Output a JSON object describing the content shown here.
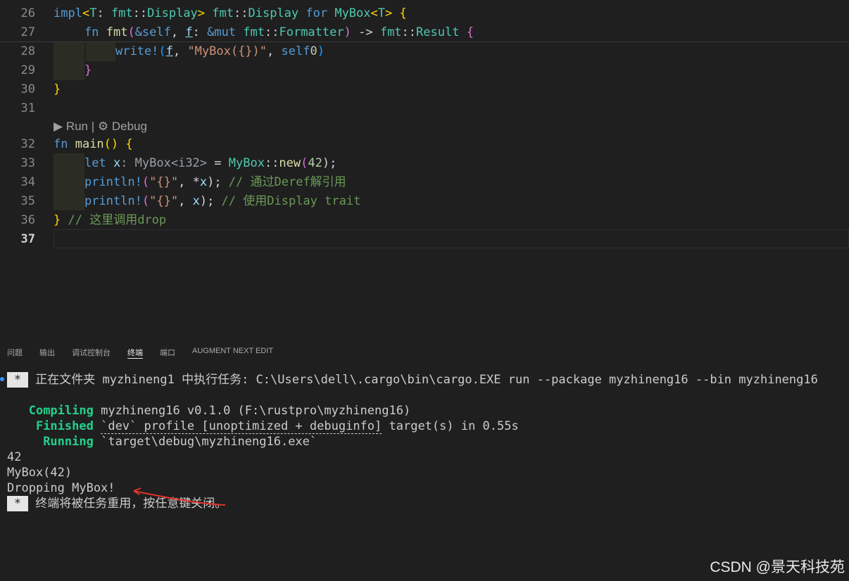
{
  "editor": {
    "line_numbers": [
      "26",
      "27",
      "28",
      "29",
      "30",
      "31",
      "32",
      "33",
      "34",
      "35",
      "36",
      "37"
    ],
    "codelens": {
      "run": "Run",
      "sep": "|",
      "debug": "Debug"
    }
  },
  "code": {
    "l26": {
      "a": "impl",
      "b": "<",
      "c": "T",
      "d": ": ",
      "e": "fmt",
      "f": "::",
      "g": "Display",
      "h": "> ",
      "i": "fmt",
      "j": "::",
      "k": "Display",
      "l": " for ",
      "m": "MyBox",
      "n": "<",
      "o": "T",
      "p": "> ",
      "q": "{"
    },
    "l27": {
      "a": "fn ",
      "b": "fmt",
      "c": "(",
      "d": "&self",
      "e": ", ",
      "f": "f",
      "g": ": ",
      "h": "&mut ",
      "i": "fmt",
      "j": "::",
      "k": "Formatter",
      "l": ") ",
      "m": "->",
      "n": " ",
      "o": "fmt",
      "p": "::",
      "q": "Result",
      "r": " ",
      "s": "{"
    },
    "l28": {
      "a": "write!",
      "b": "(",
      "c": "f",
      ". ": "",
      "d": ", ",
      "e": "\"MyBox({})\"",
      "f": ", ",
      "g": "self",
      ".": ".",
      "h": "0",
      "i": ")"
    },
    "l29": {
      "a": "}"
    },
    "l30": {
      "a": "}"
    },
    "l32": {
      "a": "fn ",
      "b": "main",
      "c": "() ",
      "d": "{"
    },
    "l33": {
      "a": "let ",
      "b": "x",
      "c": ": MyBox<i32>",
      "d": " = ",
      "e": "MyBox",
      "f": "::",
      "g": "new",
      "h": "(",
      "i": "42",
      "j": ");"
    },
    "l34": {
      "a": "println!",
      "b": "(",
      "c": "\"{}\"",
      "d": ", ",
      "e": "*",
      "f": "x",
      "g": "); ",
      "h": "// 通过Deref解引用"
    },
    "l35": {
      "a": "println!",
      "b": "(",
      "c": "\"{}\"",
      "d": ", ",
      "e": "x",
      "f": "); ",
      "g": "// 使用Display trait"
    },
    "l36": {
      "a": "}",
      "b": " // 这里调用drop"
    }
  },
  "panel": {
    "tabs": [
      "问题",
      "输出",
      "调试控制台",
      "终端",
      "端口",
      "AUGMENT NEXT EDIT"
    ],
    "active_tab": "终端"
  },
  "terminal": {
    "task_star": "*",
    "task_line": "正在文件夹 myzhineng1 中执行任务: C:\\Users\\dell\\.cargo\\bin\\cargo.EXE run --package myzhineng16 --bin myzhineng16",
    "compiling_label": "Compiling",
    "compiling_text": "myzhineng16 v0.1.0 (F:\\rustpro\\myzhineng16)",
    "finished_label": "Finished",
    "finished_profile": "`dev` profile [unoptimized + debuginfo]",
    "finished_rest": " target(s) in 0.55s",
    "running_label": "Running",
    "running_text": "`target\\debug\\myzhineng16.exe`",
    "out1": "42",
    "out2": "MyBox(42)",
    "out3": "Dropping MyBox!",
    "reuse_star": "*",
    "reuse_text": "终端将被任务重用，按任意键关闭。"
  },
  "watermark": "CSDN @景天科技苑",
  "colors": {
    "background": "#1f1f1f",
    "keyword": "#569cd6",
    "type": "#4ec9b0",
    "function": "#dcdcaa",
    "string": "#ce9178",
    "comment": "#6a9955",
    "terminal_green": "#23d18b",
    "arrow": "#e0322b"
  }
}
